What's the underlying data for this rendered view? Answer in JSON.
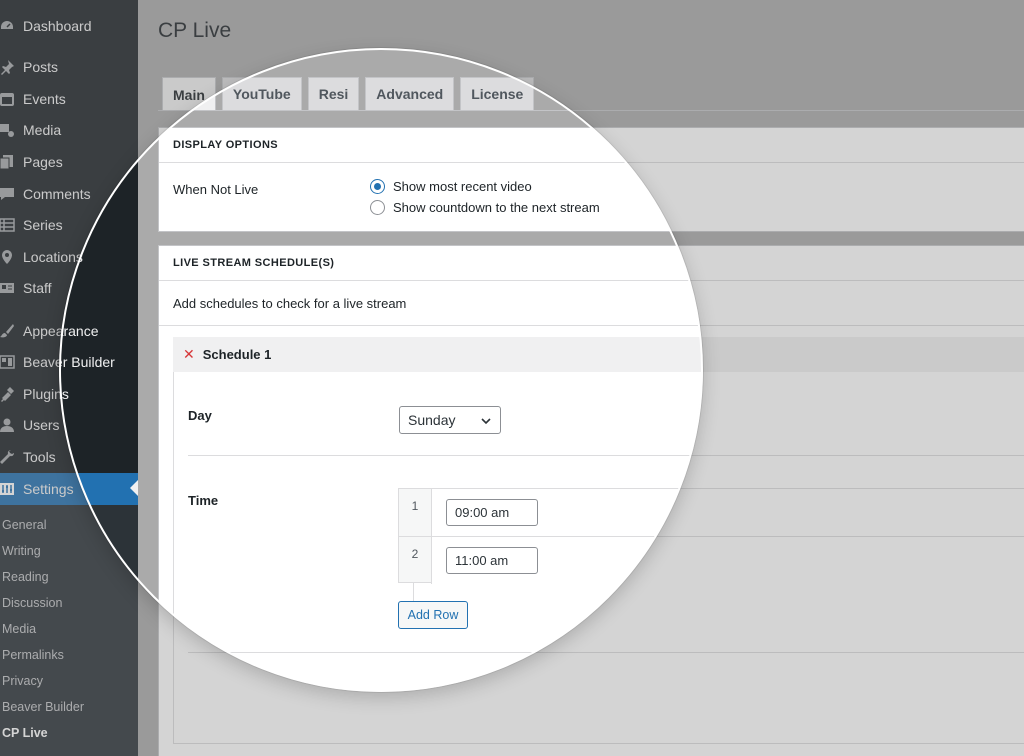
{
  "sidebar": {
    "items": [
      {
        "label": "Dashboard",
        "icon": "dashboard-icon"
      },
      {
        "label": "Posts",
        "icon": "pin-icon"
      },
      {
        "label": "Events",
        "icon": "events-icon"
      },
      {
        "label": "Media",
        "icon": "media-icon"
      },
      {
        "label": "Pages",
        "icon": "pages-icon"
      },
      {
        "label": "Comments",
        "icon": "comment-icon"
      },
      {
        "label": "Series",
        "icon": "list-icon"
      },
      {
        "label": "Locations",
        "icon": "location-icon"
      },
      {
        "label": "Staff",
        "icon": "id-card-icon"
      },
      {
        "label": "Appearance",
        "icon": "brush-icon"
      },
      {
        "label": "Beaver Builder",
        "icon": "layout-icon"
      },
      {
        "label": "Plugins",
        "icon": "plug-icon"
      },
      {
        "label": "Users",
        "icon": "user-icon"
      },
      {
        "label": "Tools",
        "icon": "wrench-icon"
      },
      {
        "label": "Settings",
        "icon": "settings-icon"
      }
    ],
    "submenu": [
      "General",
      "Writing",
      "Reading",
      "Discussion",
      "Media",
      "Permalinks",
      "Privacy",
      "Beaver Builder",
      "CP Live"
    ]
  },
  "page": {
    "title": "CP Live"
  },
  "tabs": [
    "Main",
    "YouTube",
    "Resi",
    "Advanced",
    "License"
  ],
  "display_options": {
    "heading": "DISPLAY OPTIONS",
    "label": "When Not Live",
    "options": [
      "Show most recent video",
      "Show countdown to the next stream"
    ],
    "selected": "Show most recent video"
  },
  "schedules": {
    "heading": "LIVE STREAM SCHEDULE(S)",
    "description": "Add schedules to check for a live stream",
    "schedule_title": "Schedule 1",
    "remove_symbol": "✕",
    "day_label": "Day",
    "day_value": "Sunday",
    "time_label": "Time",
    "times": [
      {
        "num": "1",
        "value": "09:00 am"
      },
      {
        "num": "2",
        "value": "11:00 am"
      }
    ],
    "add_row_label": "Add Row"
  },
  "colors": {
    "accent": "#2271b1",
    "sidebar": "#1d2327",
    "remove": "#d63638"
  }
}
